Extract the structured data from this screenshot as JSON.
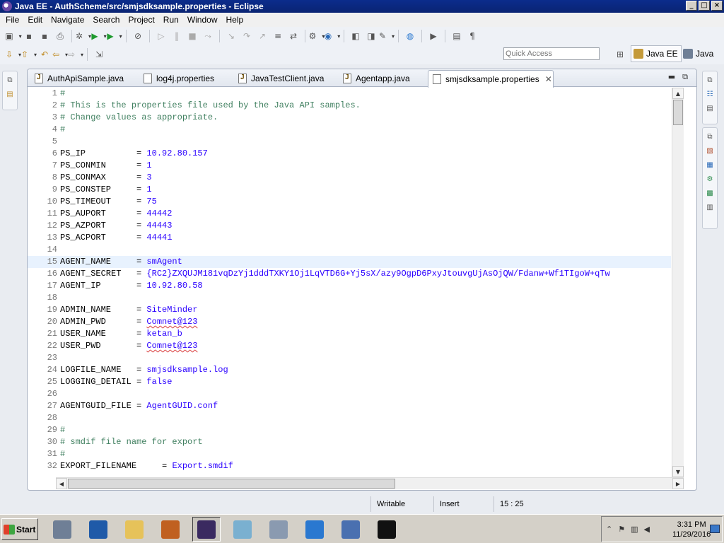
{
  "window": {
    "title": "Java EE - AuthScheme/src/smjsdksample.properties - Eclipse"
  },
  "menu": [
    "File",
    "Edit",
    "Navigate",
    "Search",
    "Project",
    "Run",
    "Window",
    "Help"
  ],
  "quick_access": {
    "placeholder": "Quick Access"
  },
  "perspectives": [
    {
      "label": "Java EE",
      "active": true,
      "icon": "javaee-perspective-icon"
    },
    {
      "label": "Java",
      "active": false,
      "icon": "java-perspective-icon"
    }
  ],
  "tabs": [
    {
      "label": "AuthApiSample.java",
      "icon": "java-file-icon",
      "active": false
    },
    {
      "label": "log4j.properties",
      "icon": "properties-file-icon",
      "active": false
    },
    {
      "label": "JavaTestClient.java",
      "icon": "java-file-icon",
      "active": false
    },
    {
      "label": "Agentapp.java",
      "icon": "java-file-icon",
      "active": false
    },
    {
      "label": "smjsdksample.properties",
      "icon": "properties-file-icon",
      "active": true
    }
  ],
  "editor": {
    "current_line": 15,
    "lines": [
      {
        "n": "1",
        "t": "#",
        "kind": "comment"
      },
      {
        "n": "2",
        "t": "# This is the properties file used by the Java API samples.",
        "kind": "comment"
      },
      {
        "n": "3",
        "t": "# Change values as appropriate.",
        "kind": "comment"
      },
      {
        "n": "4",
        "t": "#",
        "kind": "comment"
      },
      {
        "n": "5",
        "t": "",
        "kind": "blank"
      },
      {
        "n": "6",
        "k": "PS_IP          = ",
        "v": "10.92.80.157",
        "kind": "kv"
      },
      {
        "n": "7",
        "k": "PS_CONMIN      = ",
        "v": "1",
        "kind": "kv"
      },
      {
        "n": "8",
        "k": "PS_CONMAX      = ",
        "v": "3",
        "kind": "kv"
      },
      {
        "n": "9",
        "k": "PS_CONSTEP     = ",
        "v": "1",
        "kind": "kv"
      },
      {
        "n": "10",
        "k": "PS_TIMEOUT     = ",
        "v": "75",
        "kind": "kv"
      },
      {
        "n": "11",
        "k": "PS_AUPORT      = ",
        "v": "44442",
        "kind": "kv"
      },
      {
        "n": "12",
        "k": "PS_AZPORT      = ",
        "v": "44443",
        "kind": "kv"
      },
      {
        "n": "13",
        "k": "PS_ACPORT      = ",
        "v": "44441",
        "kind": "kv"
      },
      {
        "n": "14",
        "t": "",
        "kind": "blank"
      },
      {
        "n": "15",
        "k": "AGENT_NAME     = ",
        "v": "smAgent",
        "kind": "kv"
      },
      {
        "n": "16",
        "k": "AGENT_SECRET   = ",
        "v": "{RC2}ZXQUJM181vqDzYj1dddTXKY1Oj1LqVTD6G+Yj5sX/azy9OgpD6PxyJtouvgUjAsOjQW/Fdanw+Wf1TIgoW+qTw",
        "kind": "kv"
      },
      {
        "n": "17",
        "k": "AGENT_IP       = ",
        "v": "10.92.80.58",
        "kind": "kv"
      },
      {
        "n": "18",
        "t": "",
        "kind": "blank"
      },
      {
        "n": "19",
        "k": "ADMIN_NAME     = ",
        "v": "SiteMinder",
        "kind": "kv"
      },
      {
        "n": "20",
        "k": "ADMIN_PWD      = ",
        "v": "Comnet@123",
        "kind": "kv"
      },
      {
        "n": "21",
        "k": "USER_NAME      = ",
        "v": "ketan_b",
        "kind": "kv"
      },
      {
        "n": "22",
        "k": "USER_PWD       = ",
        "v": "Comnet@123",
        "kind": "kv"
      },
      {
        "n": "23",
        "t": "",
        "kind": "blank"
      },
      {
        "n": "24",
        "k": "LOGFILE_NAME   = ",
        "v": "smjsdksample.log",
        "kind": "kv"
      },
      {
        "n": "25",
        "k": "LOGGING_DETAIL = ",
        "v": "false",
        "kind": "kv"
      },
      {
        "n": "26",
        "t": "",
        "kind": "blank"
      },
      {
        "n": "27",
        "k": "AGENTGUID_FILE = ",
        "v": "AgentGUID.conf",
        "kind": "kv"
      },
      {
        "n": "28",
        "t": "",
        "kind": "blank"
      },
      {
        "n": "29",
        "t": "#",
        "kind": "comment"
      },
      {
        "n": "30",
        "t": "# smdif file name for export",
        "kind": "comment"
      },
      {
        "n": "31",
        "t": "#",
        "kind": "comment"
      },
      {
        "n": "32",
        "k": "EXPORT_FILENAME     = ",
        "v": "Export.smdif",
        "kind": "kv"
      }
    ]
  },
  "status": {
    "writable": "Writable",
    "insert_mode": "Insert",
    "position": "15 : 25"
  },
  "taskbar": {
    "start_label": "Start",
    "clock_time": "3:31 PM",
    "clock_date": "11/29/2016",
    "apps": [
      {
        "icon": "server-manager-icon",
        "color": "#6f7f96"
      },
      {
        "icon": "powershell-icon",
        "color": "#1f5aa8"
      },
      {
        "icon": "explorer-folder-icon",
        "color": "#e6c25a"
      },
      {
        "icon": "java-cup-icon",
        "color": "#c06020"
      },
      {
        "icon": "eclipse-javaee-icon",
        "color": "#3a2a60",
        "pressed": true
      },
      {
        "icon": "notepad-icon",
        "color": "#7ab0d0"
      },
      {
        "icon": "settings-gear-icon",
        "color": "#8a9ab0"
      },
      {
        "icon": "internet-explorer-icon",
        "color": "#2a78d0"
      },
      {
        "icon": "network-icon",
        "color": "#4a70b0"
      },
      {
        "icon": "command-prompt-icon",
        "color": "#111111"
      }
    ]
  },
  "colors": {
    "title_bar": "#0b2c8c",
    "current_line": "#e8f2fe",
    "value": "#2a00ff",
    "comment": "#3f7f5f"
  }
}
